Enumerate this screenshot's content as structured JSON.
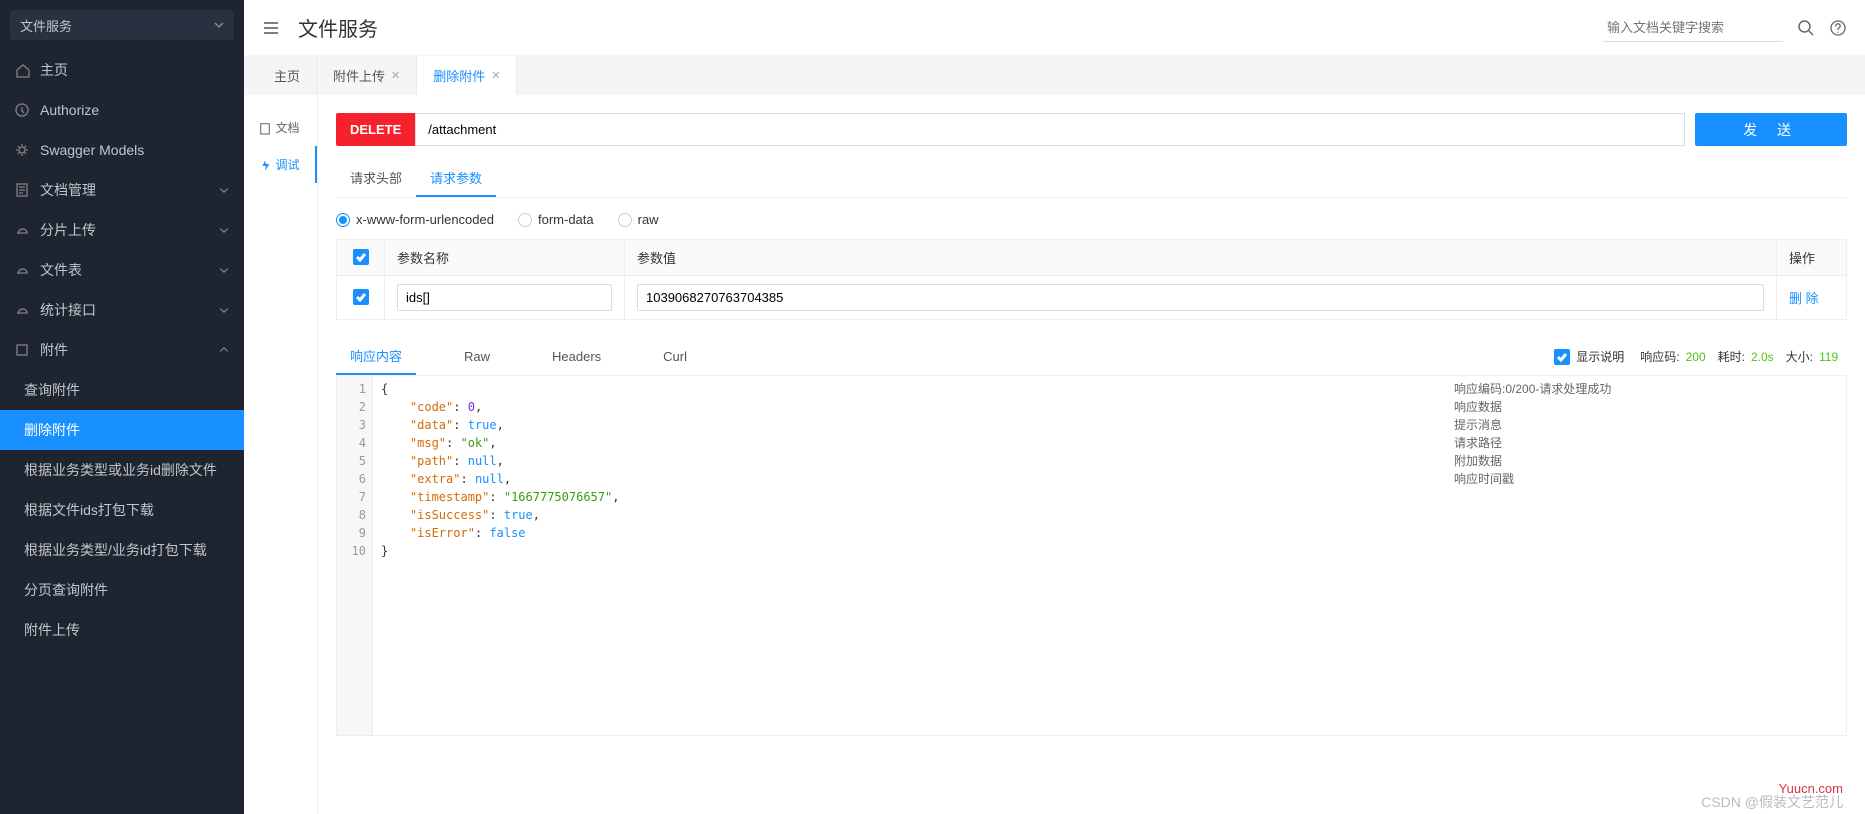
{
  "sidebar": {
    "service_label": "文件服务",
    "items": [
      {
        "label": "主页"
      },
      {
        "label": "Authorize"
      },
      {
        "label": "Swagger Models"
      },
      {
        "label": "文档管理",
        "expandable": true
      },
      {
        "label": "分片上传",
        "expandable": true
      },
      {
        "label": "文件表",
        "expandable": true
      },
      {
        "label": "统计接口",
        "expandable": true
      },
      {
        "label": "附件",
        "expandable": true,
        "expanded": true,
        "children": [
          {
            "label": "查询附件"
          },
          {
            "label": "删除附件",
            "active": true
          },
          {
            "label": "根据业务类型或业务id删除文件"
          },
          {
            "label": "根据文件ids打包下载"
          },
          {
            "label": "根据业务类型/业务id打包下载"
          },
          {
            "label": "分页查询附件"
          },
          {
            "label": "附件上传"
          }
        ]
      }
    ]
  },
  "header": {
    "title": "文件服务",
    "search_placeholder": "输入文档关键字搜索"
  },
  "tabs": [
    {
      "label": "主页"
    },
    {
      "label": "附件上传",
      "closable": true
    },
    {
      "label": "删除附件",
      "closable": true,
      "active": true
    }
  ],
  "inner_tabs": [
    {
      "label": "文档"
    },
    {
      "label": "调试",
      "active": true
    }
  ],
  "request": {
    "method": "DELETE",
    "url": "/attachment",
    "send_label": "发 送",
    "subtabs": [
      {
        "label": "请求头部"
      },
      {
        "label": "请求参数",
        "active": true
      }
    ],
    "body_types": [
      {
        "label": "x-www-form-urlencoded",
        "selected": true
      },
      {
        "label": "form-data"
      },
      {
        "label": "raw"
      }
    ],
    "param_table": {
      "headers": {
        "name": "参数名称",
        "value": "参数值",
        "op": "操作"
      },
      "rows": [
        {
          "checked": true,
          "name": "ids[]",
          "value": "1039068270763704385"
        }
      ],
      "delete_label": "删 除"
    }
  },
  "response": {
    "tabs": [
      {
        "label": "响应内容",
        "active": true
      },
      {
        "label": "Raw"
      },
      {
        "label": "Headers"
      },
      {
        "label": "Curl"
      }
    ],
    "show_explain_label": "显示说明",
    "show_explain": true,
    "meta": {
      "code_label": "响应码:",
      "code": "200",
      "time_label": "耗时:",
      "time": "2.0s",
      "size_label": "大小:",
      "size": "119"
    },
    "json_lines": [
      "{",
      "    \"code\": 0,",
      "    \"data\": true,",
      "    \"msg\": \"ok\",",
      "    \"path\": null,",
      "    \"extra\": null,",
      "    \"timestamp\": \"1667775076657\",",
      "    \"isSuccess\": true,",
      "    \"isError\": false",
      "}"
    ],
    "explain": [
      "响应编码:0/200-请求处理成功",
      "响应数据",
      "提示消息",
      "请求路径",
      "附加数据",
      "响应时间戳"
    ]
  },
  "watermarks": {
    "brand": "Yuucn.com",
    "csdn": "CSDN @假装文艺范儿"
  }
}
